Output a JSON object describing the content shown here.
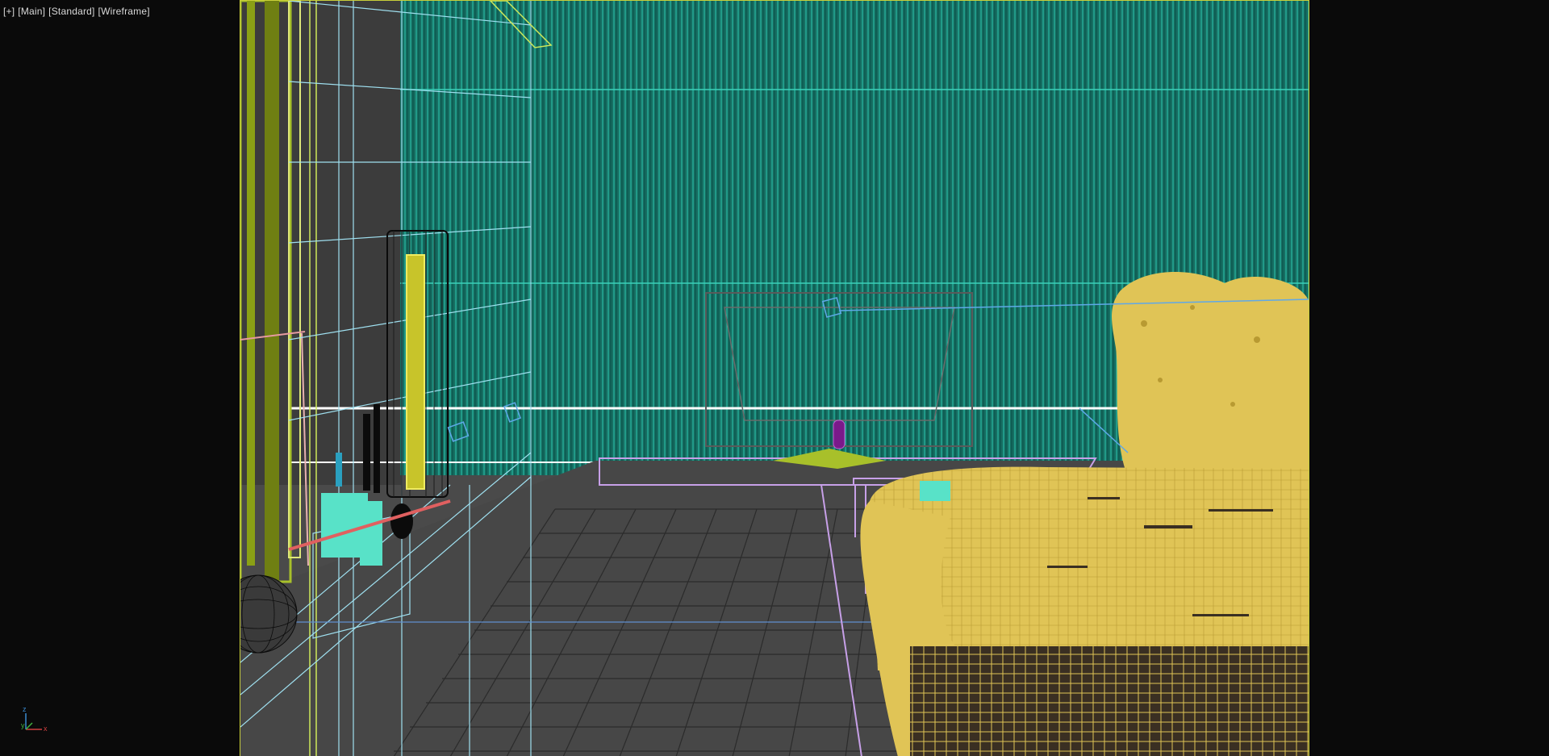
{
  "viewport": {
    "label_plus": "[+]",
    "label_view": "[Main]",
    "label_shading_standard": "[Standard]",
    "label_shading_mode": "[Wireframe]"
  },
  "axis": {
    "z": "z",
    "y": "y",
    "x": "x"
  },
  "colors": {
    "background": "#0a0a0a",
    "viewport_bg": "#4a4a4a",
    "wall_teal": "#0f8a7a",
    "wire_yellow": "#e2c455",
    "wire_lime": "#a8c02a",
    "wire_cyan": "#9fe0f0",
    "object_cyan": "#58e2c8",
    "object_purple": "#7a1a8a",
    "frame_border": "#c9cf3a"
  },
  "icons": [
    "world-axis-icon"
  ]
}
